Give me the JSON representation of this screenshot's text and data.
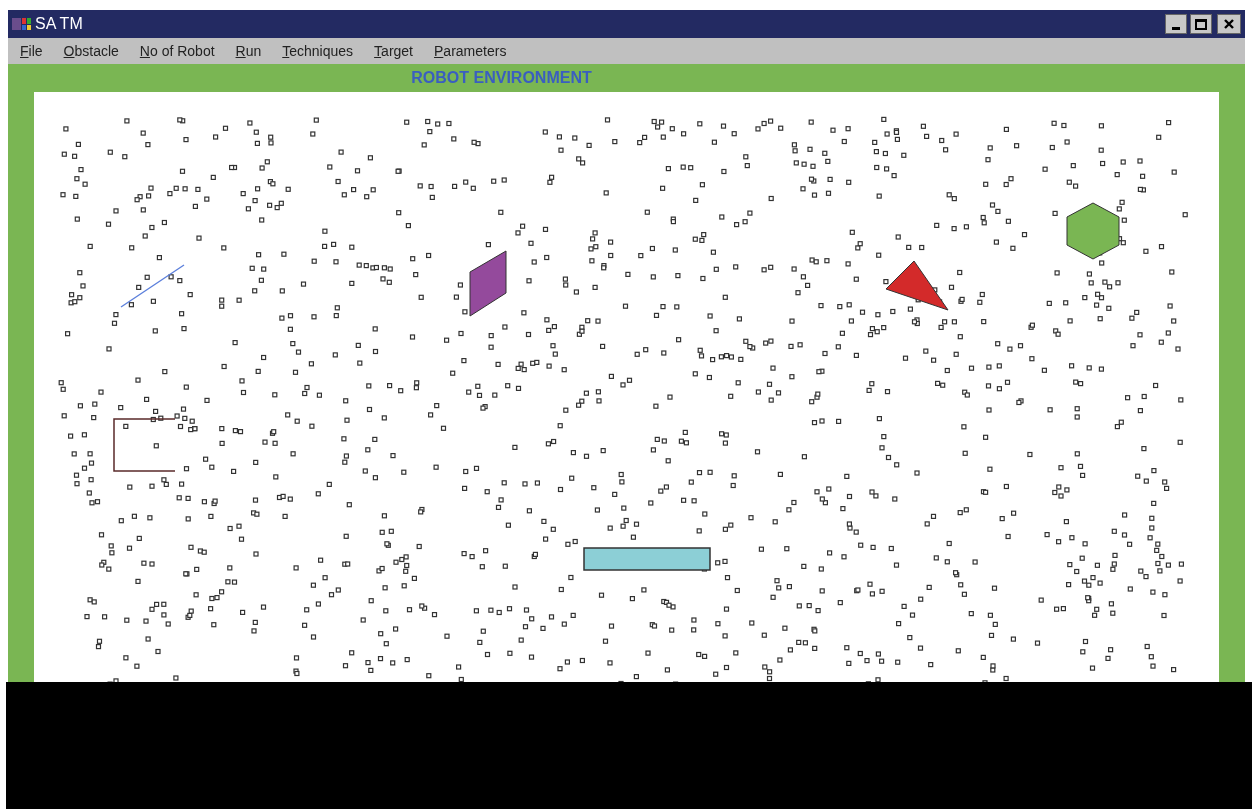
{
  "window": {
    "title": "SA TM"
  },
  "menu": [
    "File",
    "Obstacle",
    "No of Robot",
    "Run",
    "Techniques",
    "Target",
    "Parameters"
  ],
  "heading": "ROBOT ENVIRONMENT"
}
